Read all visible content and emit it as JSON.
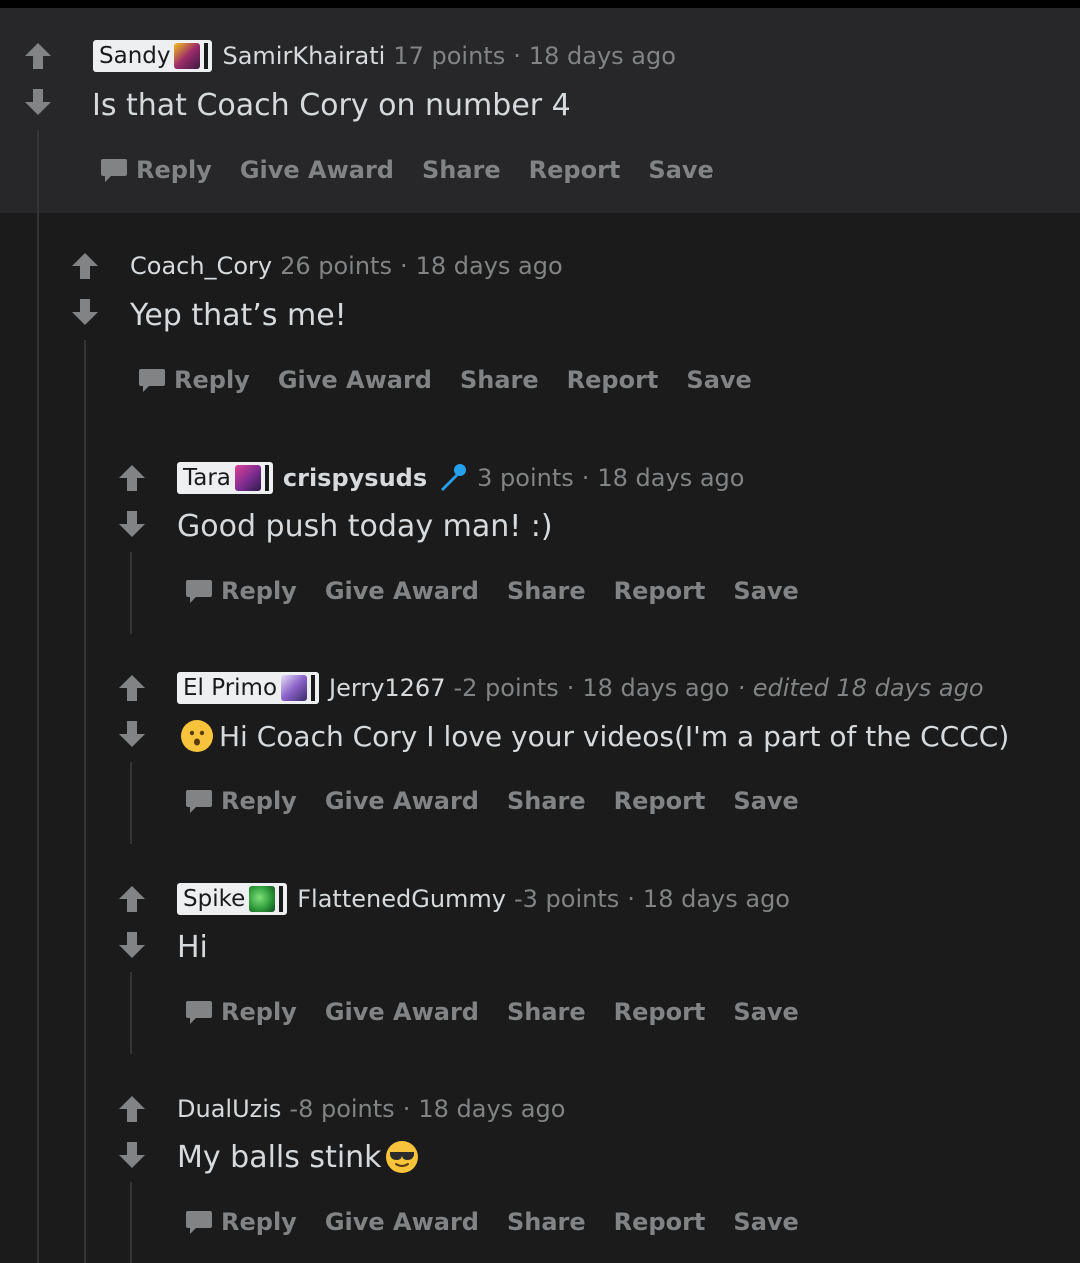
{
  "comments": [
    {
      "flair": "Sandy",
      "author": "SamirKhairati",
      "points": "17 points",
      "sep": "·",
      "time": "18 days ago",
      "body": "Is that Coach Cory on number 4"
    },
    {
      "flair": "",
      "author": "Coach_Cory",
      "points": "26 points",
      "sep": "·",
      "time": "18 days ago",
      "body": "Yep that’s me!"
    },
    {
      "flair": "Tara",
      "author": "crispysuds",
      "points": "3 points",
      "sep": "·",
      "time": "18 days ago",
      "body": "Good push today man! :)"
    },
    {
      "flair": "El Primo",
      "author": "Jerry1267",
      "points": "-2 points",
      "sep": "·",
      "time": "18 days ago",
      "edited": "· edited 18 days ago",
      "body": "Hi Coach Cory I love your videos(I'm a part of the CCCC)"
    },
    {
      "flair": "Spike",
      "author": "FlattenedGummy",
      "points": "-3 points",
      "sep": "·",
      "time": "18 days ago",
      "body": "Hi"
    },
    {
      "flair": "",
      "author": "DualUzis",
      "points": "-8 points",
      "sep": "·",
      "time": "18 days ago",
      "body": "My balls stink"
    }
  ],
  "actions": {
    "reply": "Reply",
    "give_award": "Give Award",
    "share": "Share",
    "report": "Report",
    "save": "Save"
  },
  "colors": {
    "background": "#1b1b1b",
    "highlight": "#272729",
    "text": "#d7dadc",
    "muted": "#818384",
    "flair_bg": "#edeff1",
    "mic": "#24a0ed"
  },
  "icons": [
    "upvote-icon",
    "downvote-icon",
    "comment-bubble-icon",
    "microphone-icon",
    "hushed-face-emoji-icon",
    "sunglasses-emoji-icon"
  ]
}
